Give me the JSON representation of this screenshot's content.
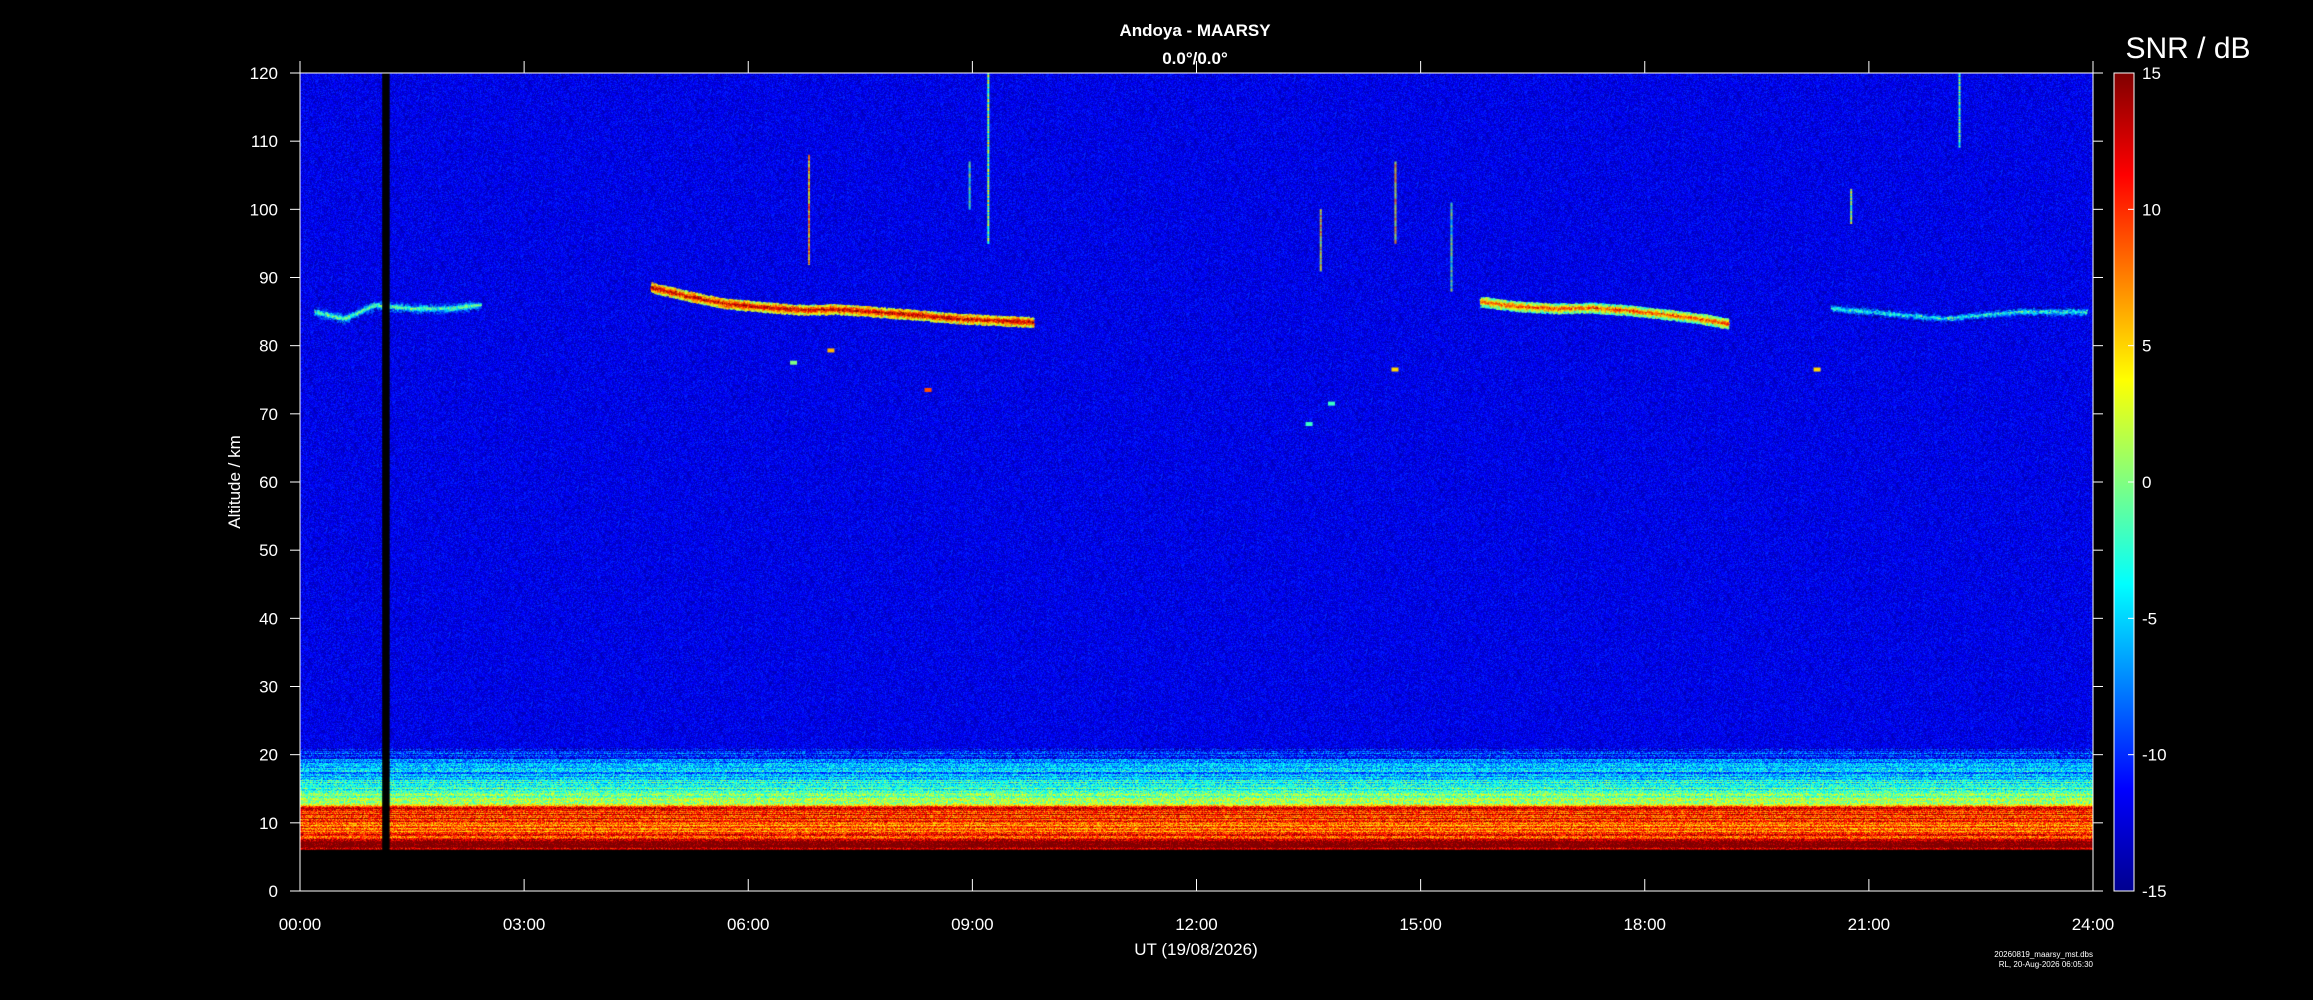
{
  "chart_data": {
    "type": "heatmap",
    "title": "Andoya - MAARSY",
    "subtitle": "0.0°/0.0°",
    "xlabel": "UT (19/08/2026)",
    "ylabel": "Altitude / km",
    "colorbar_label": "SNR / dB",
    "xlim": [
      0,
      24
    ],
    "ylim": [
      0,
      120
    ],
    "clim": [
      -15,
      15
    ],
    "x_ticks": [
      "00:00",
      "03:00",
      "06:00",
      "09:00",
      "12:00",
      "15:00",
      "18:00",
      "21:00",
      "24:00"
    ],
    "y_ticks": [
      0,
      10,
      20,
      30,
      40,
      50,
      60,
      70,
      80,
      90,
      100,
      110,
      120
    ],
    "colorbar_ticks": [
      -15,
      -10,
      -5,
      0,
      5,
      10,
      15
    ],
    "colormap": [
      "#00008f",
      "#0000ff",
      "#0080ff",
      "#00ffff",
      "#80ff80",
      "#ffff00",
      "#ff8000",
      "#ff0000",
      "#800000"
    ],
    "background_snr_db": -12,
    "data_gap": {
      "start": 1.1,
      "end": 1.2,
      "alt_min": 6,
      "alt_max": 120
    },
    "layers": [
      {
        "name": "troposphere",
        "alt_min": 6,
        "alt_max": 21,
        "t_start": 0,
        "t_end": 24,
        "peak_snr_db": 15
      },
      {
        "name": "pmse-morning",
        "points": [
          [
            4.7,
            88.6
          ],
          [
            5.2,
            87.3
          ],
          [
            5.7,
            86.2
          ],
          [
            6.2,
            85.7
          ],
          [
            6.7,
            85.3
          ],
          [
            7.2,
            85.4
          ],
          [
            7.7,
            85.0
          ],
          [
            8.2,
            84.6
          ],
          [
            8.7,
            84.1
          ],
          [
            9.2,
            83.8
          ],
          [
            9.8,
            83.5
          ]
        ],
        "peak_snr_db": 12
      },
      {
        "name": "pmse-evening",
        "points": [
          [
            15.8,
            86.5
          ],
          [
            16.3,
            85.8
          ],
          [
            16.8,
            85.5
          ],
          [
            17.3,
            85.6
          ],
          [
            17.8,
            85.2
          ],
          [
            18.3,
            84.6
          ],
          [
            18.8,
            83.9
          ],
          [
            19.1,
            83.3
          ]
        ],
        "peak_snr_db": 8
      },
      {
        "name": "weak-echoes-early",
        "points": [
          [
            0.2,
            85.0
          ],
          [
            0.6,
            84.0
          ],
          [
            1.0,
            86.0
          ],
          [
            1.5,
            85.5
          ],
          [
            2.0,
            85.5
          ],
          [
            2.4,
            86.0
          ]
        ],
        "peak_snr_db": -2
      },
      {
        "name": "weak-echoes-late",
        "points": [
          [
            20.5,
            85.5
          ],
          [
            21.0,
            85.0
          ],
          [
            22.0,
            84.0
          ],
          [
            23.0,
            85.0
          ],
          [
            23.9,
            85.0
          ]
        ],
        "peak_snr_db": -4
      }
    ],
    "meteor_streaks": [
      {
        "t": 6.8,
        "alt_min": 92,
        "alt_max": 108,
        "snr_db": 6
      },
      {
        "t": 8.95,
        "alt_min": 100,
        "alt_max": 107,
        "snr_db": -2
      },
      {
        "t": 9.2,
        "alt_min": 95,
        "alt_max": 120,
        "snr_db": 0
      },
      {
        "t": 13.65,
        "alt_min": 91,
        "alt_max": 100,
        "snr_db": 4
      },
      {
        "t": 14.65,
        "alt_min": 95,
        "alt_max": 107,
        "snr_db": 4
      },
      {
        "t": 15.4,
        "alt_min": 88,
        "alt_max": 101,
        "snr_db": -2
      },
      {
        "t": 20.75,
        "alt_min": 98,
        "alt_max": 103,
        "snr_db": 0
      },
      {
        "t": 22.2,
        "alt_min": 109,
        "alt_max": 120,
        "snr_db": -2
      }
    ],
    "spot_echoes": [
      {
        "t": 6.6,
        "alt": 77.5,
        "snr_db": 0
      },
      {
        "t": 7.1,
        "alt": 79.3,
        "snr_db": 6
      },
      {
        "t": 8.4,
        "alt": 73.5,
        "snr_db": 9
      },
      {
        "t": 13.5,
        "alt": 68.5,
        "snr_db": -2
      },
      {
        "t": 13.8,
        "alt": 71.5,
        "snr_db": -2
      },
      {
        "t": 14.65,
        "alt": 76.5,
        "snr_db": 5
      },
      {
        "t": 20.3,
        "alt": 76.5,
        "snr_db": 5
      }
    ]
  },
  "footer": {
    "filename": "20260819_maarsy_mst.dbs",
    "credit": "RL, 20-Aug-2026 06:05:30"
  }
}
